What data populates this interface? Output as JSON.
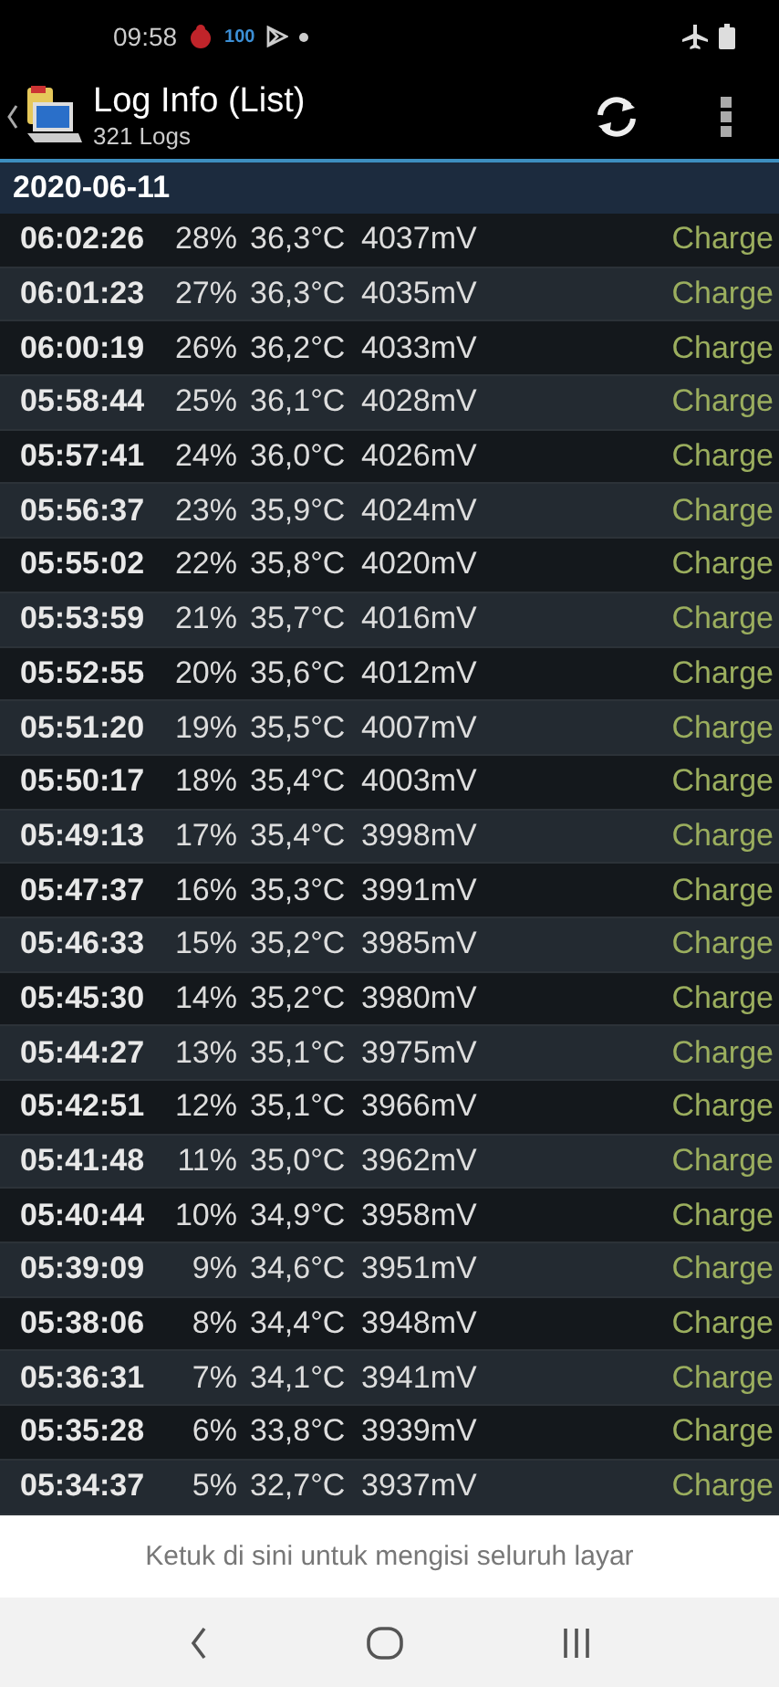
{
  "status_bar": {
    "time": "09:58",
    "battery_text": "100"
  },
  "header": {
    "title": "Log Info (List)",
    "subtitle": "321 Logs"
  },
  "date_header": "2020-06-11",
  "rows": [
    {
      "time": "06:02:26",
      "percent": "28%",
      "temp": "36,3°C",
      "voltage": "4037mV",
      "status": "Charge",
      "cut_off": false
    },
    {
      "time": "06:01:23",
      "percent": "27%",
      "temp": "36,3°C",
      "voltage": "4035mV",
      "status": "Charge",
      "cut_off": false
    },
    {
      "time": "06:00:19",
      "percent": "26%",
      "temp": "36,2°C",
      "voltage": "4033mV",
      "status": "Charge",
      "cut_off": false
    },
    {
      "time": "05:58:44",
      "percent": "25%",
      "temp": "36,1°C",
      "voltage": "4028mV",
      "status": "Charge",
      "cut_off": false
    },
    {
      "time": "05:57:41",
      "percent": "24%",
      "temp": "36,0°C",
      "voltage": "4026mV",
      "status": "Charge",
      "cut_off": false
    },
    {
      "time": "05:56:37",
      "percent": "23%",
      "temp": "35,9°C",
      "voltage": "4024mV",
      "status": "Charge",
      "cut_off": false
    },
    {
      "time": "05:55:02",
      "percent": "22%",
      "temp": "35,8°C",
      "voltage": "4020mV",
      "status": "Charge",
      "cut_off": false
    },
    {
      "time": "05:53:59",
      "percent": "21%",
      "temp": "35,7°C",
      "voltage": "4016mV",
      "status": "Charge",
      "cut_off": false
    },
    {
      "time": "05:52:55",
      "percent": "20%",
      "temp": "35,6°C",
      "voltage": "4012mV",
      "status": "Charge",
      "cut_off": false
    },
    {
      "time": "05:51:20",
      "percent": "19%",
      "temp": "35,5°C",
      "voltage": "4007mV",
      "status": "Charge",
      "cut_off": false
    },
    {
      "time": "05:50:17",
      "percent": "18%",
      "temp": "35,4°C",
      "voltage": "4003mV",
      "status": "Charge",
      "cut_off": false
    },
    {
      "time": "05:49:13",
      "percent": "17%",
      "temp": "35,4°C",
      "voltage": "3998mV",
      "status": "Charge",
      "cut_off": false
    },
    {
      "time": "05:47:37",
      "percent": "16%",
      "temp": "35,3°C",
      "voltage": "3991mV",
      "status": "Charge",
      "cut_off": false
    },
    {
      "time": "05:46:33",
      "percent": "15%",
      "temp": "35,2°C",
      "voltage": "3985mV",
      "status": "Charge",
      "cut_off": false
    },
    {
      "time": "05:45:30",
      "percent": "14%",
      "temp": "35,2°C",
      "voltage": "3980mV",
      "status": "Charge",
      "cut_off": false
    },
    {
      "time": "05:44:27",
      "percent": "13%",
      "temp": "35,1°C",
      "voltage": "3975mV",
      "status": "Charge",
      "cut_off": false
    },
    {
      "time": "05:42:51",
      "percent": "12%",
      "temp": "35,1°C",
      "voltage": "3966mV",
      "status": "Charge",
      "cut_off": false
    },
    {
      "time": "05:41:48",
      "percent": "11%",
      "temp": "35,0°C",
      "voltage": "3962mV",
      "status": "Charge",
      "cut_off": false
    },
    {
      "time": "05:40:44",
      "percent": "10%",
      "temp": "34,9°C",
      "voltage": "3958mV",
      "status": "Charge",
      "cut_off": false
    },
    {
      "time": "05:39:09",
      "percent": "9%",
      "temp": "34,6°C",
      "voltage": "3951mV",
      "status": "Charge",
      "cut_off": false
    },
    {
      "time": "05:38:06",
      "percent": "8%",
      "temp": "34,4°C",
      "voltage": "3948mV",
      "status": "Charge",
      "cut_off": false
    },
    {
      "time": "05:36:31",
      "percent": "7%",
      "temp": "34,1°C",
      "voltage": "3941mV",
      "status": "Charge",
      "cut_off": false
    },
    {
      "time": "05:35:28",
      "percent": "6%",
      "temp": "33,8°C",
      "voltage": "3939mV",
      "status": "Charge",
      "cut_off": false
    },
    {
      "time": "05:34:37",
      "percent": "5%",
      "temp": "32,7°C",
      "voltage": "3937mV",
      "status": "Charge",
      "cut_off": false
    }
  ],
  "fullscreen_hint": "Ketuk di sini untuk mengisi seluruh layar"
}
